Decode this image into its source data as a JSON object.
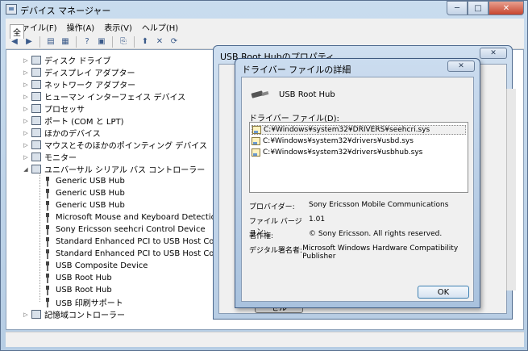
{
  "window": {
    "title": "デバイス マネージャー",
    "minimize": "─",
    "maximize": "□",
    "close": "✕"
  },
  "menu": [
    "ファイル(F)",
    "操作(A)",
    "表示(V)",
    "ヘルプ(H)"
  ],
  "toolbar": {
    "back": "◀",
    "forward": "▶",
    "buttons": [
      "▤",
      "▦",
      "?",
      "▣",
      "⎘",
      "⬆",
      "✕",
      "⟳"
    ]
  },
  "tree": {
    "categories_top": [
      {
        "label": "ディスク ドライブ",
        "icon": "disk-icon"
      },
      {
        "label": "ディスプレイ アダプター",
        "icon": "display-icon"
      },
      {
        "label": "ネットワーク アダプター",
        "icon": "network-icon"
      },
      {
        "label": "ヒューマン インターフェイス デバイス",
        "icon": "hid-icon"
      },
      {
        "label": "プロセッサ",
        "icon": "processor-icon"
      },
      {
        "label": "ポート (COM と LPT)",
        "icon": "port-icon"
      },
      {
        "label": "ほかのデバイス",
        "icon": "other-device-icon"
      },
      {
        "label": "マウスとそのほかのポインティング デバイス",
        "icon": "mouse-icon"
      },
      {
        "label": "モニター",
        "icon": "monitor-icon"
      }
    ],
    "usb_controllers": {
      "label": "ユニバーサル シリアル バス コントローラー",
      "children": [
        "Generic USB Hub",
        "Generic USB Hub",
        "Generic USB Hub",
        "Microsoft Mouse and Keyboard Detection Drive",
        "Sony Ericsson seehcri Control Device",
        "Standard Enhanced PCI to USB Host Controlle",
        "Standard Enhanced PCI to USB Host Controlle",
        "USB Composite Device",
        "USB Root Hub",
        "USB Root Hub",
        "USB 印刷サポート"
      ]
    },
    "categories_bottom": [
      {
        "label": "記憶域コントローラー",
        "icon": "storage-icon"
      }
    ]
  },
  "properties_dialog": {
    "title": "USB Root Hubのプロパティ",
    "close": "✕",
    "tab_fragment": "全",
    "cancel_fragment": "セル"
  },
  "driver_dialog": {
    "title": "ドライバー ファイルの詳細",
    "close": "✕",
    "device_name": "USB Root Hub",
    "files_label": "ドライバー ファイル(D):",
    "files": [
      "C:¥Windows¥system32¥DRIVERS¥seehcri.sys",
      "C:¥Windows¥system32¥drivers¥usbd.sys",
      "C:¥Windows¥system32¥drivers¥usbhub.sys"
    ],
    "provider_label": "プロバイダー:",
    "provider_value": "Sony Ericsson Mobile Communications",
    "version_label": "ファイル バージョン:",
    "version_value": "1.01",
    "copyright_label": "著作権:",
    "copyright_value": "© Sony Ericsson. All rights reserved.",
    "signer_label": "デジタル署名者:",
    "signer_value": "Microsoft Windows Hardware Compatibility Publisher",
    "ok_label": "OK"
  }
}
